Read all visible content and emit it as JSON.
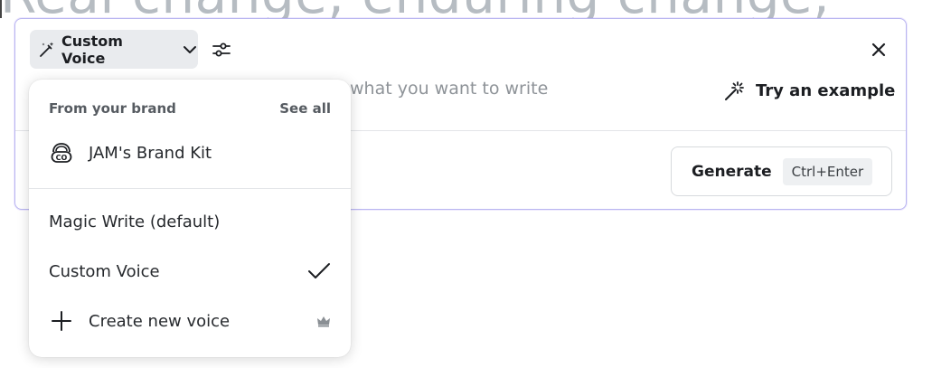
{
  "background": {
    "heading": "Real change, enduring change,"
  },
  "toolbar": {
    "voice_label": "Custom Voice",
    "voice_icon": "magic-wand-icon",
    "chevron_icon": "chevron-down-icon",
    "settings_icon": "sliders-icon",
    "close_icon": "close-icon"
  },
  "prompt": {
    "placeholder_visible": "what you want to write"
  },
  "try_example": {
    "label": "Try an example",
    "icon": "sparkle-wand-icon"
  },
  "generate": {
    "label": "Generate",
    "shortcut": "Ctrl+Enter"
  },
  "dropdown": {
    "section_title": "From your brand",
    "see_all_label": "See all",
    "brand_kit": {
      "label": "JAM's Brand Kit",
      "icon": "brand-kit-icon"
    },
    "options": [
      {
        "label": "Magic Write (default)",
        "selected": false
      },
      {
        "label": "Custom Voice",
        "selected": true
      }
    ],
    "create": {
      "label": "Create new voice",
      "icon": "plus-icon",
      "badge_icon": "crown-icon"
    }
  },
  "colors": {
    "panel_border": "#b9b6f0",
    "text_primary": "#1c1e22",
    "muted": "#8e9398",
    "heading_grey": "#b6bcc2"
  }
}
